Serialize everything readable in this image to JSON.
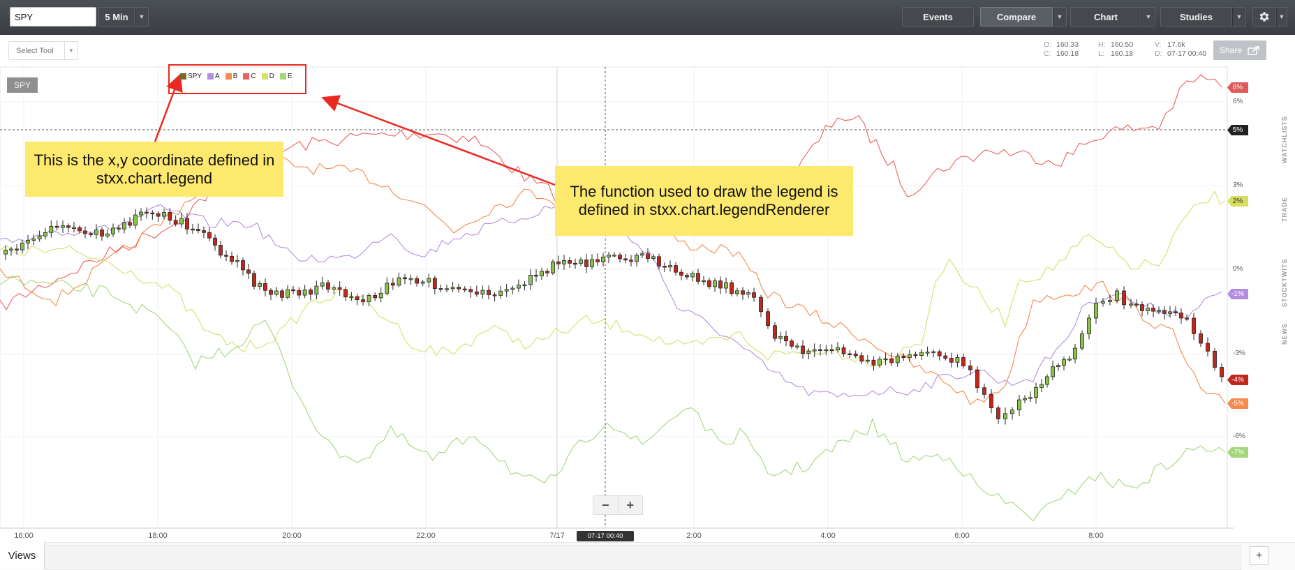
{
  "toolbar": {
    "symbol_value": "SPY",
    "interval_label": "5 Min",
    "events_label": "Events",
    "compare_label": "Compare",
    "chart_label": "Chart",
    "studies_label": "Studies"
  },
  "subbar": {
    "select_tool_label": "Select Tool",
    "share_label": "Share",
    "hud": {
      "open_label": "O:",
      "open": "160.33",
      "close_label": "C:",
      "close": "160.18",
      "high_label": "H:",
      "high": "160.50",
      "low_label": "L:",
      "low": "160.18",
      "volume_label": "V:",
      "volume": "17.6k",
      "date_label": "D:",
      "date": "07-17 00:40"
    }
  },
  "chart": {
    "symbol_badge": "SPY",
    "legend": [
      {
        "name": "SPY",
        "color": "#7a6a2a"
      },
      {
        "name": "A",
        "color": "#b48ede"
      },
      {
        "name": "B",
        "color": "#f58a4c"
      },
      {
        "name": "C",
        "color": "#ee5f5f"
      },
      {
        "name": "D",
        "color": "#d4e06a"
      },
      {
        "name": "E",
        "color": "#a6d67a"
      }
    ],
    "y_axis_labels": [
      "6%",
      "3%",
      "0%",
      "-3%",
      "-6%"
    ],
    "y_tags": [
      {
        "text": "6%",
        "bg": "#e05a5a",
        "fg": "#ffffff"
      },
      {
        "text": "5%",
        "bg": "#222222",
        "fg": "#ffffff"
      },
      {
        "text": "2%",
        "bg": "#d6e05e",
        "fg": "#333333"
      },
      {
        "text": "-1%",
        "bg": "#b48ede",
        "fg": "#ffffff"
      },
      {
        "text": "-4%",
        "bg": "#c0281e",
        "fg": "#ffffff"
      },
      {
        "text": "-5%",
        "bg": "#f58a4c",
        "fg": "#ffffff"
      },
      {
        "text": "-7%",
        "bg": "#a6d67a",
        "fg": "#ffffff"
      }
    ],
    "x_axis_labels": [
      "16:00",
      "18:00",
      "20:00",
      "22:00",
      "7/17",
      "2:00",
      "4:00",
      "6:00",
      "8:00"
    ],
    "crosshair_label": "07-17 00:40",
    "zoom_out_label": "−",
    "zoom_in_label": "+"
  },
  "annotations": {
    "callout_left": "This is the x,y coordinate defined in stxx.chart.legend",
    "callout_right": "The function used to draw the legend is defined in stxx.chart.legendRenderer"
  },
  "side_tabs": [
    "WATCHLISTS",
    "TRADE",
    "STOCKTWITS",
    "NEWS"
  ],
  "bottom": {
    "views_label": "Views",
    "add_label": "+"
  },
  "icons": {
    "gear": "gear-icon",
    "share": "share-icon",
    "caret": "caret-down-icon"
  }
}
